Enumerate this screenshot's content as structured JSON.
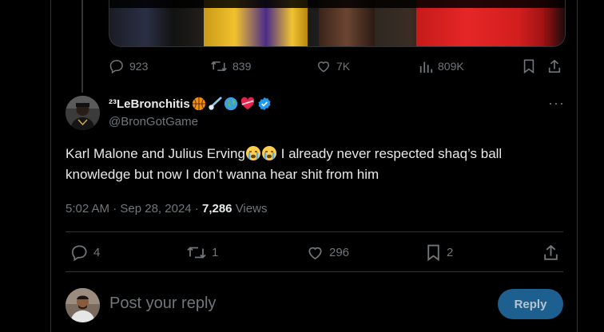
{
  "parent_tweet": {
    "actions": {
      "replies": "923",
      "reposts": "839",
      "likes": "7K",
      "views": "809K"
    }
  },
  "tweet": {
    "display_name": "²³LeBronchitis",
    "display_emojis": [
      "basketball",
      "comet",
      "globe",
      "heart-with-ribbon"
    ],
    "handle": "@BronGotGame",
    "text_part1": "Karl Malone and Julius Erving",
    "text_part2": " I already never respected shaq’s ball knowledge but now I don’t wanna hear shit from him",
    "text_emojis": [
      "loudly-crying-face",
      "loudly-crying-face"
    ],
    "time": "5:02 AM",
    "date": "Sep 28, 2024",
    "views_count": "7,286",
    "views_label": " Views",
    "actions": {
      "replies": "4",
      "reposts": "1",
      "likes": "296",
      "bookmarks": "2"
    }
  },
  "reply_box": {
    "placeholder": "Post your reply",
    "button_label": "Reply"
  },
  "colors": {
    "background": "#000000",
    "text_primary": "#e7e9ea",
    "text_secondary": "#71767b",
    "border": "#2f3336",
    "verified": "#1d9bf0",
    "reply_button": "#1d5f8f"
  }
}
